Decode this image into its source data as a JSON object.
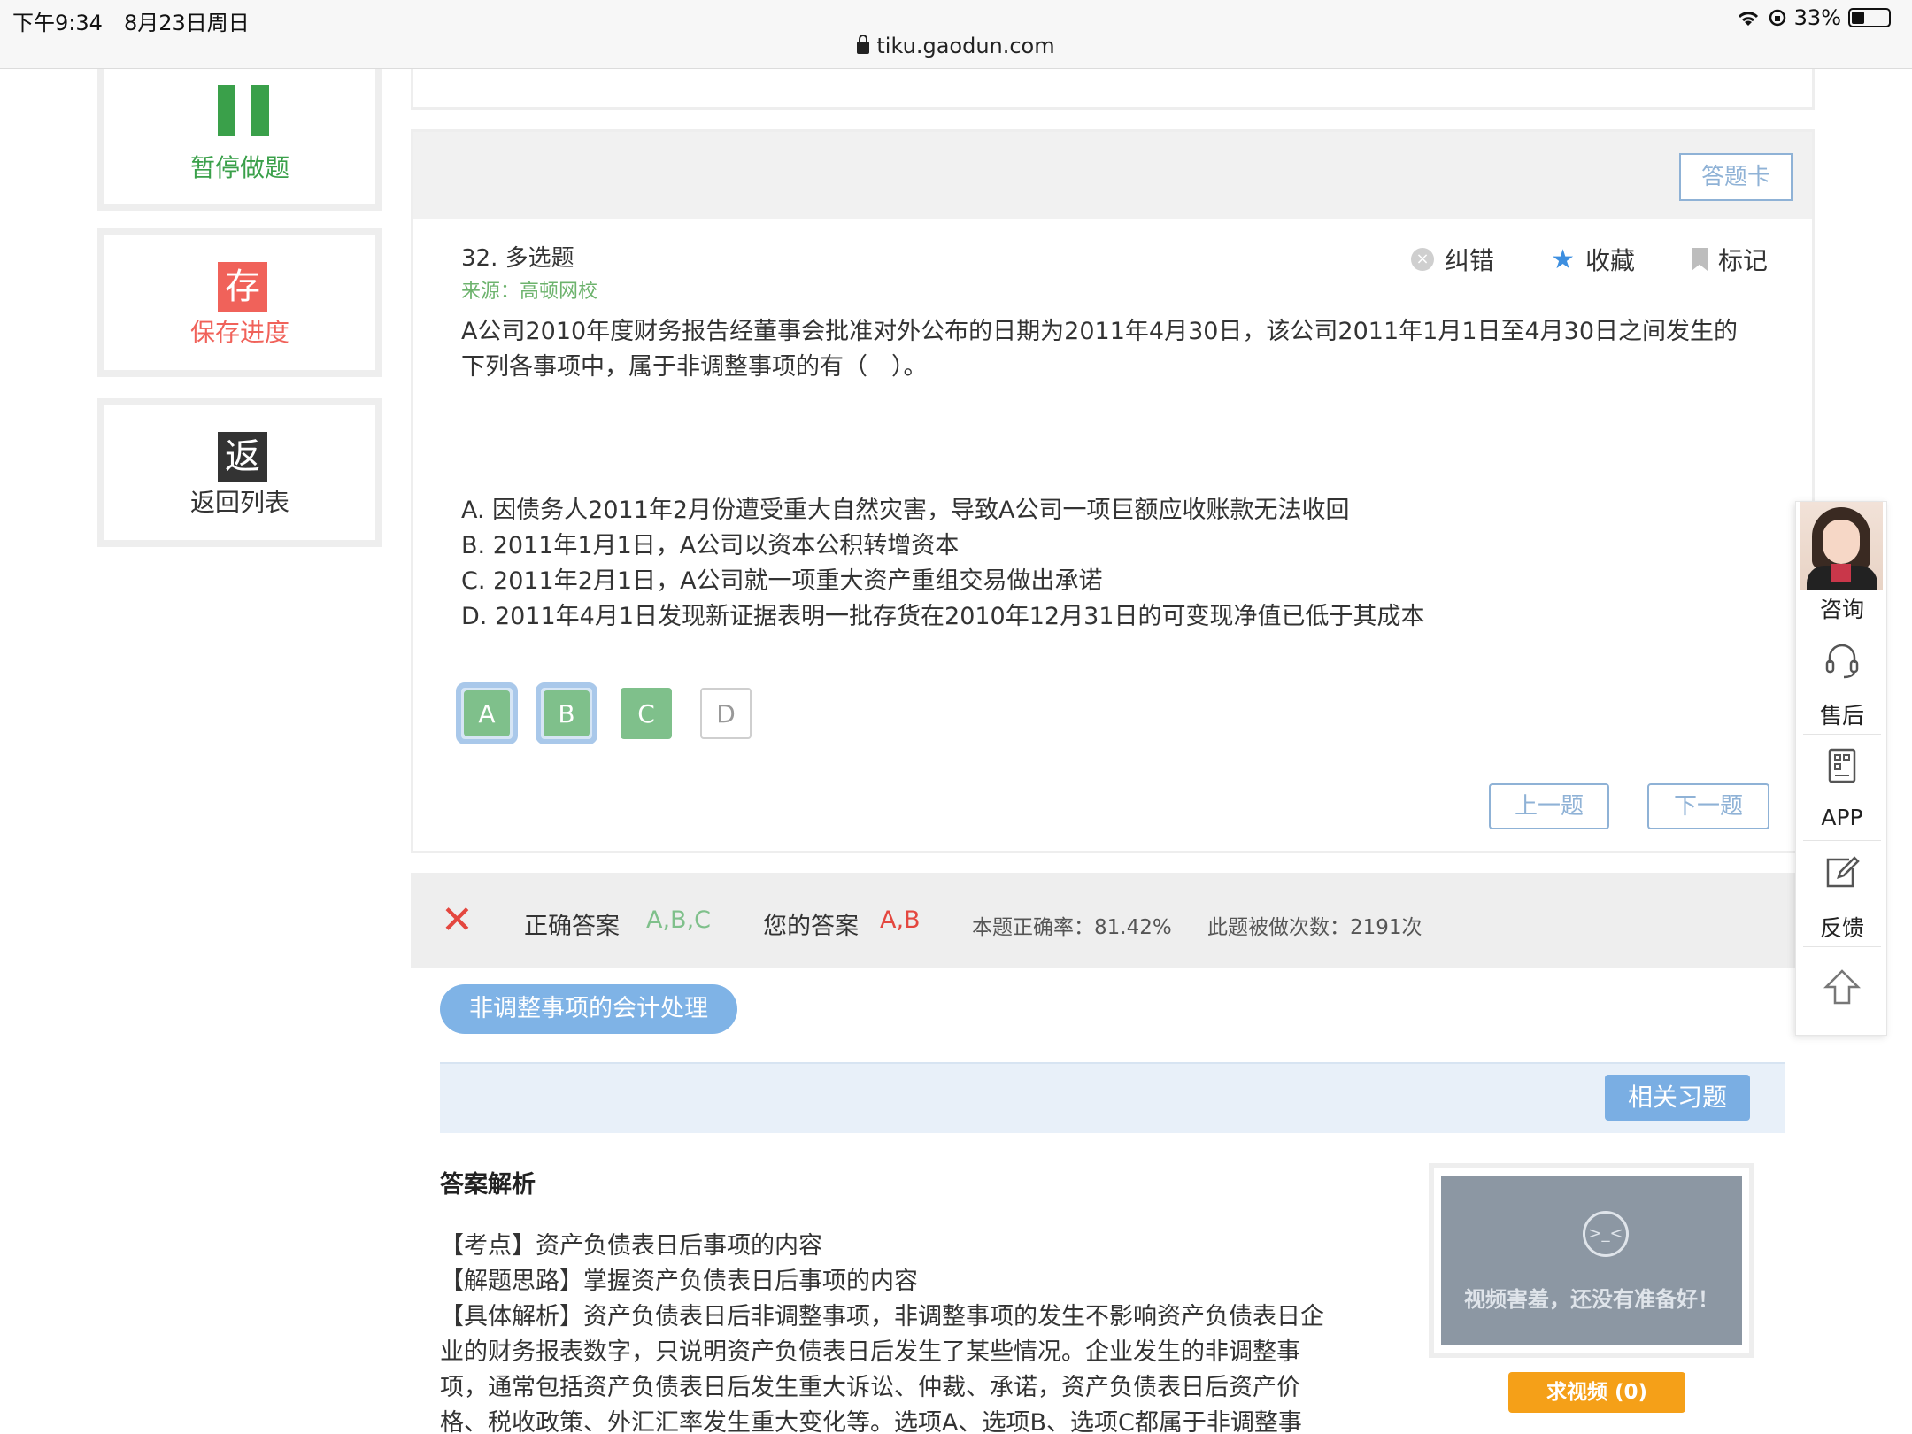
{
  "status": {
    "time": "下午9:34",
    "date": "8月23日周日",
    "right": "33%",
    "url": "tiku.gaodun.com"
  },
  "sidebar": {
    "pause_label": "暂停做题",
    "save_icon": "存",
    "save_label": "保存进度",
    "back_icon": "返",
    "back_label": "返回列表",
    "colors": {
      "pause": "#3aa04a",
      "save": "#f0625a",
      "back": "#333333"
    }
  },
  "question": {
    "answer_card": "答题卡",
    "title": "32. 多选题",
    "source_label": "来源：",
    "source": "高顿网校",
    "actions": {
      "report": "纠错",
      "favorite": "收藏",
      "mark": "标记"
    },
    "stem_line1": "A公司2010年度财务报告经董事会批准对外公布的日期为2011年4月30日，该公司2011年1月1日至4月30日之间发生的",
    "stem_line2": "下列各事项中，属于非调整事项的有（　）。",
    "options": [
      "A. 因债务人2011年2月份遭受重大自然灾害，导致A公司一项巨额应收账款无法收回",
      "B. 2011年1月1日，A公司以资本公积转增资本",
      "C. 2011年2月1日，A公司就一项重大资产重组交易做出承诺",
      "D. 2011年4月1日发现新证据表明一批存货在2010年12月31日的可变现净值已低于其成本"
    ],
    "choices": [
      "A",
      "B",
      "C",
      "D"
    ],
    "prev": "上一题",
    "next": "下一题"
  },
  "result": {
    "correct_label": "正确答案",
    "correct_value": "A,B,C",
    "your_label": "您的答案",
    "your_value": "A,B",
    "rate_label": "本题正确率：81.42%",
    "count_label": "此题被做次数：2191次"
  },
  "tag": "非调整事项的会计处理",
  "related_btn": "相关习题",
  "analysis": {
    "title": "答案解析",
    "lines": [
      "【考点】资产负债表日后事项的内容",
      "【解题思路】掌握资产负债表日后事项的内容",
      "【具体解析】资产负债表日后非调整事项，非调整事项的发生不影响资产负债表日企",
      "业的财务报表数字，只说明资产负债表日后发生了某些情况。企业发生的非调整事",
      "项，通常包括资产负债表日后发生重大诉讼、仲裁、承诺，资产负债表日后资产价",
      "格、税收政策、外汇汇率发生重大变化等。选项A、选项B、选项C都属于非调整事"
    ]
  },
  "video": {
    "face": ">_<",
    "text": "视频害羞，还没有准备好！",
    "request": "求视频 (0)"
  },
  "float": {
    "consult": "咨询",
    "after_sale": "售后",
    "app": "APP",
    "feedback": "反馈"
  }
}
